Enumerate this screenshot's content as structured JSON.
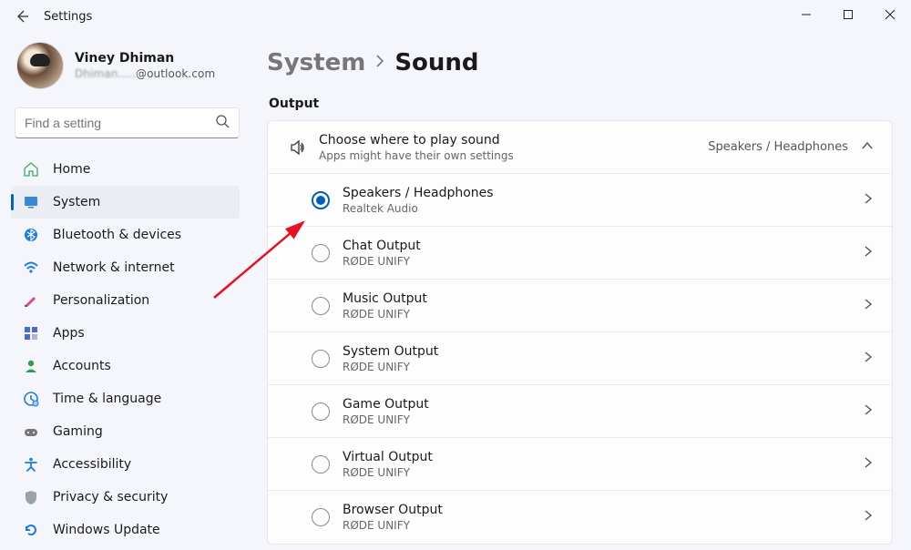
{
  "window": {
    "title": "Settings"
  },
  "profile": {
    "name": "Viney Dhiman",
    "email": "Dhiman.....@outlook.com"
  },
  "search": {
    "placeholder": "Find a setting"
  },
  "nav": {
    "items": [
      {
        "id": "home",
        "label": "Home"
      },
      {
        "id": "system",
        "label": "System"
      },
      {
        "id": "bluetooth",
        "label": "Bluetooth & devices"
      },
      {
        "id": "network",
        "label": "Network & internet"
      },
      {
        "id": "personalization",
        "label": "Personalization"
      },
      {
        "id": "apps",
        "label": "Apps"
      },
      {
        "id": "accounts",
        "label": "Accounts"
      },
      {
        "id": "time",
        "label": "Time & language"
      },
      {
        "id": "gaming",
        "label": "Gaming"
      },
      {
        "id": "accessibility",
        "label": "Accessibility"
      },
      {
        "id": "privacy",
        "label": "Privacy & security"
      },
      {
        "id": "update",
        "label": "Windows Update"
      }
    ]
  },
  "breadcrumb": {
    "parent": "System",
    "page": "Sound"
  },
  "output": {
    "section": "Output",
    "header": {
      "title": "Choose where to play sound",
      "subtitle": "Apps might have their own settings",
      "summary": "Speakers / Headphones"
    },
    "devices": [
      {
        "title": "Speakers / Headphones",
        "sub": "Realtek Audio",
        "selected": true
      },
      {
        "title": "Chat Output",
        "sub": "RØDE UNIFY",
        "selected": false
      },
      {
        "title": "Music Output",
        "sub": "RØDE UNIFY",
        "selected": false
      },
      {
        "title": "System Output",
        "sub": "RØDE UNIFY",
        "selected": false
      },
      {
        "title": "Game Output",
        "sub": "RØDE UNIFY",
        "selected": false
      },
      {
        "title": "Virtual Output",
        "sub": "RØDE UNIFY",
        "selected": false
      },
      {
        "title": "Browser Output",
        "sub": "RØDE UNIFY",
        "selected": false
      }
    ]
  }
}
